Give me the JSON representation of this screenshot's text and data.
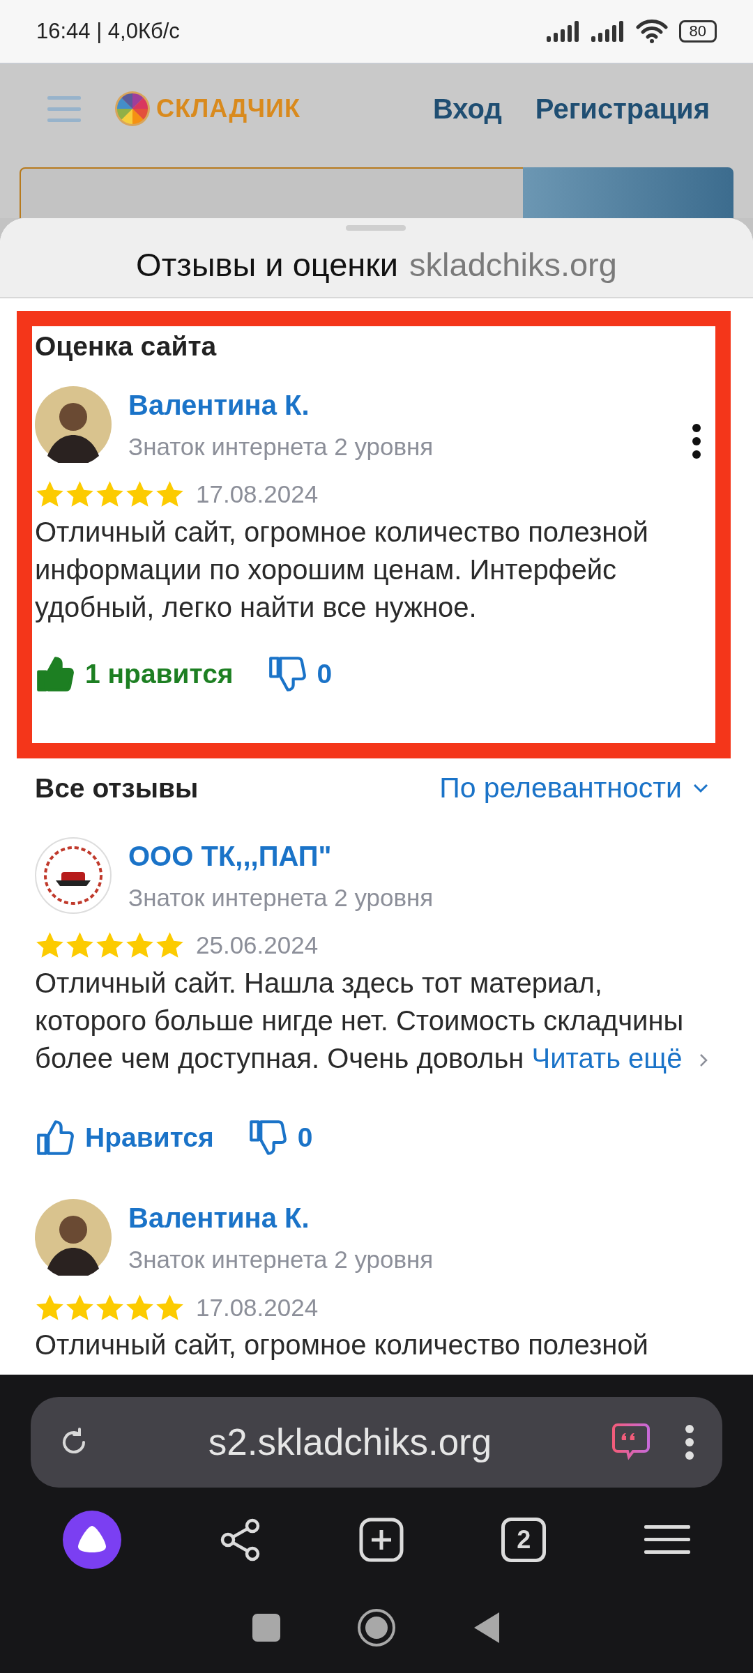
{
  "status_bar": {
    "time_speed": "16:44 | 4,0Кб/с",
    "battery": "80"
  },
  "site_header": {
    "logo": "СКЛАДЧИК",
    "links": [
      "Вход",
      "Регистрация"
    ]
  },
  "sheet": {
    "title": "Отзывы и оценки",
    "domain": "skladchiks.org"
  },
  "featured": {
    "heading": "Оценка сайта",
    "review": {
      "author": "Валентина К.",
      "kind": "person",
      "rank": "Знаток интернета 2 уровня",
      "stars": 5,
      "date": "17.08.2024",
      "text": "Отличный сайт, огромное количество полезной информации по хорошим ценам. Интерфейс удобный, легко найти все нужное.",
      "liked": true,
      "likes_label": "1 нравится",
      "dislikes": "0"
    }
  },
  "all_reviews": {
    "heading": "Все отзывы",
    "sort": "По релевантности",
    "reviews": [
      {
        "author": "ООО ТК,,,ПАП\"",
        "kind": "company",
        "rank": "Знаток интернета 2 уровня",
        "stars": 5,
        "date": "25.06.2024",
        "text": "Отличный сайт. Нашла здесь тот материал, которого больше нигде нет. Стоимость складчины более чем доступная. Очень довольн",
        "read_more": "Читать ещё",
        "liked": false,
        "likes_label": "Нравится",
        "dislikes": "0"
      },
      {
        "author": "Валентина К.",
        "kind": "person",
        "rank": "Знаток интернета 2 уровня",
        "stars": 5,
        "date": "17.08.2024",
        "text": "Отличный сайт, огромное количество полезной"
      }
    ]
  },
  "browser": {
    "url": "s2.skladchiks.org",
    "tabs_count": "2"
  }
}
